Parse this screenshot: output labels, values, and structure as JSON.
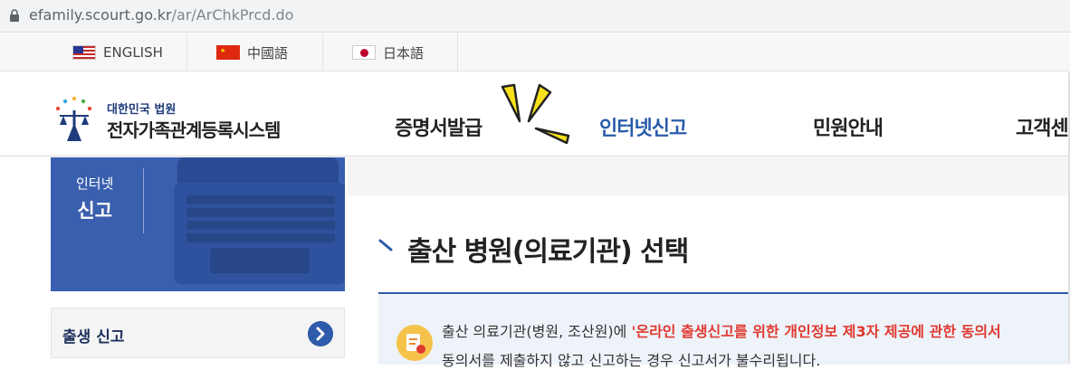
{
  "browser": {
    "url_host": "efamily.scourt.go.kr",
    "url_path": "/ar/ArChkPrcd.do"
  },
  "languages": [
    {
      "label": "ENGLISH",
      "flag": "us-flag-icon"
    },
    {
      "label": "中國語",
      "flag": "cn-flag-icon"
    },
    {
      "label": "日本語",
      "flag": "jp-flag-icon"
    }
  ],
  "logo": {
    "subtitle": "대한민국 법원",
    "title": "전자가족관계등록시스템"
  },
  "nav": [
    {
      "label": "증명서발급",
      "active": false
    },
    {
      "label": "인터넷신고",
      "active": true
    },
    {
      "label": "민원안내",
      "active": false
    },
    {
      "label": "고객센",
      "active": false
    }
  ],
  "sidebar": {
    "banner": {
      "line1": "인터넷",
      "line2": "신고"
    },
    "menu": [
      {
        "label": "출생 신고"
      }
    ]
  },
  "main": {
    "title": "출산 병원(의료기관) 선택",
    "notice": {
      "line1_prefix": "출산 의료기관(병원, 조산원)에 ",
      "line1_highlight": "'온라인 출생신고를 위한 개인정보 제3자 제공에 관한 동의서",
      "line2": "동의서를 제출하지 않고 신고하는 경우 신고서가 불수리됩니다."
    }
  },
  "colors": {
    "brand": "#2e5cab",
    "banner": "#3a5faf",
    "highlight": "#e0392f",
    "spark": "#f7e11b"
  }
}
